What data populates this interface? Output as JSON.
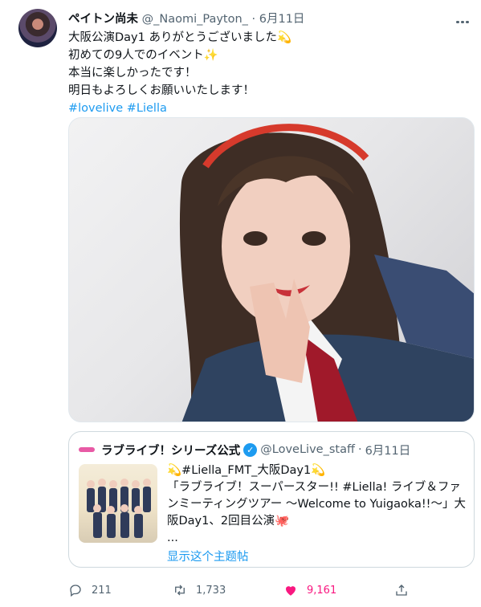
{
  "tweet": {
    "display_name": "ペイトン尚未",
    "handle": "@_Naomi_Payton_",
    "separator": "·",
    "date": "6月11日",
    "lines": [
      "大阪公演Day1 ありがとうございました💫",
      "初めての9人でのイベント✨",
      "本当に楽しかったです！",
      "明日もよろしくお願いいたします！"
    ],
    "hashtags": [
      "#lovelive",
      "#Liella"
    ]
  },
  "quote": {
    "display_name": "ラブライブ！シリーズ公式",
    "handle": "@LoveLive_staff",
    "separator": "·",
    "date": "6月11日",
    "lines": [
      "💫#Liella_FMT_大阪Day1💫",
      "「ラブライブ！スーパースター!! #Liella! ライブ＆ファ",
      "ンミーティングツアー ～Welcome to Yuigaoka!!～」大",
      "阪Day1、2回目公演🐙",
      "..."
    ],
    "show_thread": "显示这个主题帖"
  },
  "actions": {
    "replies": "211",
    "retweets": "1,733",
    "likes": "9,161"
  },
  "icons": {
    "more": "more-icon",
    "verified": "verified-badge-icon",
    "reply": "reply-icon",
    "retweet": "retweet-icon",
    "like": "heart-icon",
    "share": "share-icon"
  },
  "colors": {
    "accent": "#1d9bf0",
    "like": "#f91880",
    "secondary_text": "#536471"
  }
}
